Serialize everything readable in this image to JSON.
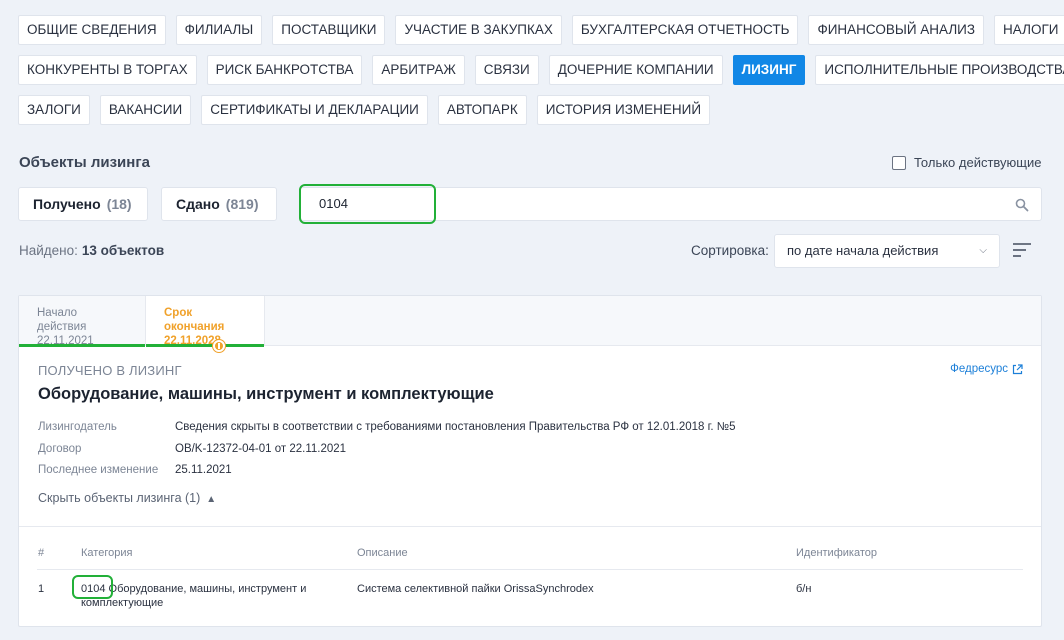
{
  "tabs": {
    "row1": [
      "ОБЩИЕ СВЕДЕНИЯ",
      "ФИЛИАЛЫ",
      "ПОСТАВЩИКИ",
      "УЧАСТИЕ В ЗАКУПКАХ",
      "БУХГАЛТЕРСКАЯ ОТЧЕТНОСТЬ",
      "ФИНАНСОВЫЙ АНАЛИЗ",
      "НАЛОГИ"
    ],
    "row2": [
      "КОНКУРЕНТЫ В ТОРГАХ",
      "РИСК БАНКРОТСТВА",
      "АРБИТРАЖ",
      "СВЯЗИ",
      "ДОЧЕРНИЕ КОМПАНИИ",
      "ЛИЗИНГ",
      "ИСПОЛНИТЕЛЬНЫЕ ПРОИЗВОДСТВА"
    ],
    "row3": [
      "ЗАЛОГИ",
      "ВАКАНСИИ",
      "СЕРТИФИКАТЫ И ДЕКЛАРАЦИИ",
      "АВТОПАРК",
      "ИСТОРИЯ ИЗМЕНЕНИЙ"
    ],
    "active": "ЛИЗИНГ"
  },
  "section": {
    "title": "Объекты лизинга",
    "only_active_label": "Только действующие"
  },
  "toggles": {
    "received_label": "Получено",
    "received_count": "(18)",
    "given_label": "Сдано",
    "given_count": "(819)"
  },
  "search": {
    "value": "0104"
  },
  "results": {
    "found_label": "Найдено:",
    "found_value": "13 объектов"
  },
  "sort": {
    "label": "Сортировка:",
    "value": "по дате начала действия"
  },
  "card": {
    "start_label": "Начало действия",
    "start_date": "22.11.2021",
    "end_label": "Срок окончания",
    "end_date": "22.11.2028",
    "type": "ПОЛУЧЕНО В ЛИЗИНГ",
    "source_link": "Федресурс",
    "title": "Оборудование, машины, инструмент и комплектующие",
    "fields": [
      {
        "key": "Лизингодатель",
        "value": "Сведения скрыты в соответствии с требованиями постановления Правительства РФ от 12.01.2018 г. №5"
      },
      {
        "key": "Договор",
        "value": "OB/K-12372-04-01 от 22.11.2021"
      },
      {
        "key": "Последнее изменение",
        "value": "25.11.2021"
      }
    ],
    "collapse_label": "Скрыть объекты лизинга (1)"
  },
  "table": {
    "headers": [
      "#",
      "Категория",
      "Описание",
      "Идентификатор"
    ],
    "rows": [
      {
        "num": "1",
        "code": "0104",
        "category": "Оборудование, машины, инструмент и",
        "category2": "комплектующие",
        "description": "Система селективной пайки OrissaSynchrodex",
        "id": "б/н"
      }
    ]
  },
  "colors": {
    "accent": "#1187e6",
    "highlight": "#22b038",
    "orange": "#f0a12a"
  }
}
